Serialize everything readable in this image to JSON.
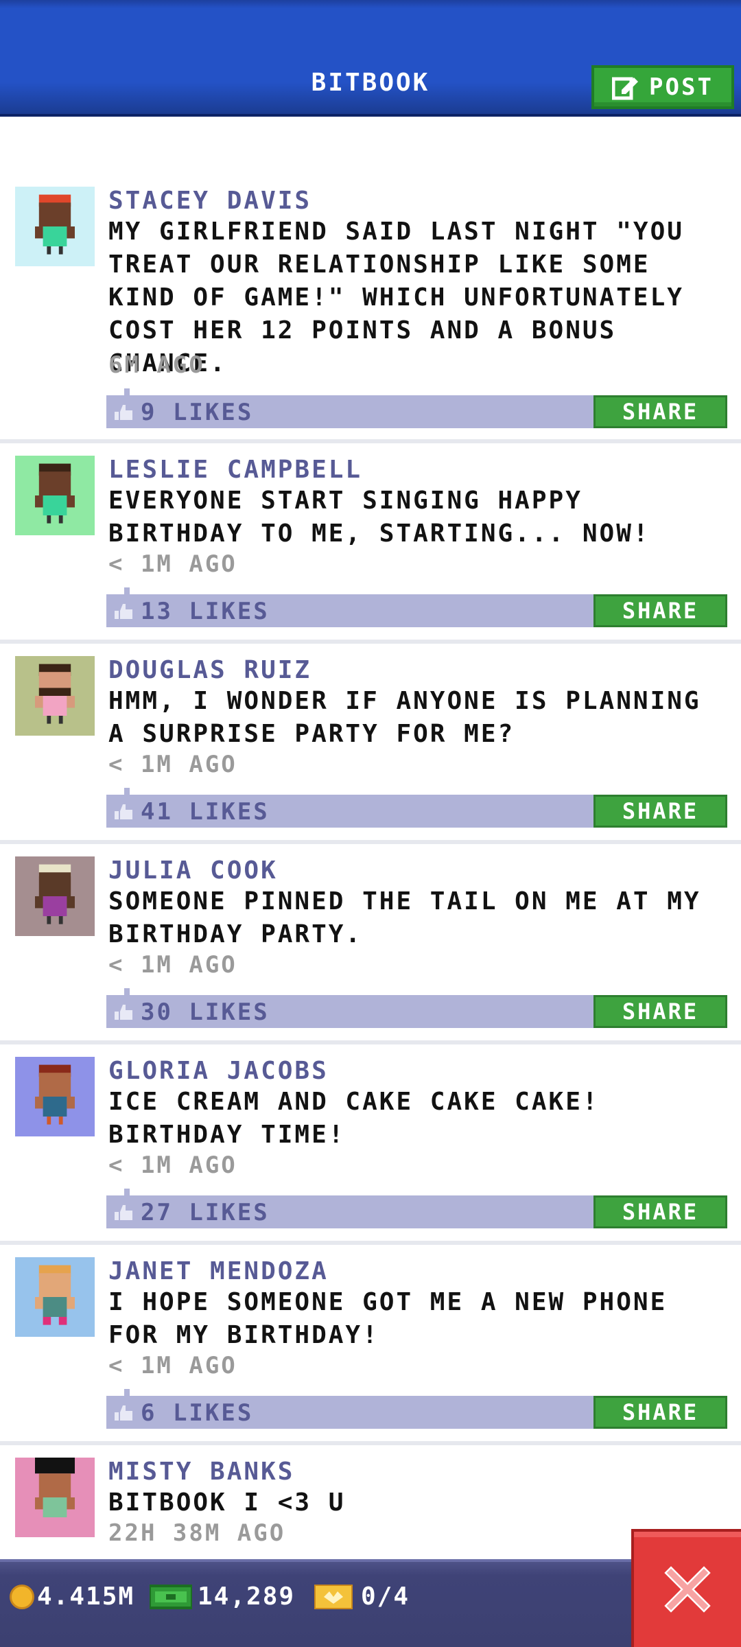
{
  "header": {
    "title": "BITBOOK",
    "post_label": "POST"
  },
  "posts": [
    {
      "author": "STACEY DAVIS",
      "message": "MY GIRLFRIEND SAID LAST NIGHT \"YOU TREAT OUR RELATIONSHIP LIKE SOME KIND OF GAME!\" WHICH UNFORTUNATELY COST HER 12 POINTS AND A BONUS CHANCE.",
      "time": "6M AGO",
      "likes": "9 LIKES",
      "share": "SHARE",
      "avatar_bg": "#cdf1f7",
      "skin": "#6b3f2a",
      "hair": "#e0472b",
      "shirt": "#39d49a"
    },
    {
      "author": "LESLIE CAMPBELL",
      "message": "EVERYONE START SINGING HAPPY BIRTHDAY TO ME, STARTING... NOW!",
      "time": "< 1M AGO",
      "likes": "13 LIKES",
      "share": "SHARE",
      "avatar_bg": "#8fe9a3",
      "skin": "#6b3f2a",
      "hair": "#3b2416",
      "shirt": "#39d49a"
    },
    {
      "author": "DOUGLAS RUIZ",
      "message": "HMM, I WONDER IF ANYONE IS PLANNING A SURPRISE PARTY FOR ME?",
      "time": "< 1M AGO",
      "likes": "41 LIKES",
      "share": "SHARE",
      "avatar_bg": "#b8c18a",
      "skin": "#d79a7c",
      "hair": "#3b2416",
      "shirt": "#f2a4c3"
    },
    {
      "author": "JULIA COOK",
      "message": "SOMEONE PINNED THE TAIL ON ME AT MY BIRTHDAY PARTY.",
      "time": "< 1M AGO",
      "likes": "30 LIKES",
      "share": "SHARE",
      "avatar_bg": "#a58e90",
      "skin": "#5a3a28",
      "hair": "#e8e4c8",
      "shirt": "#9a3fa0"
    },
    {
      "author": "GLORIA JACOBS",
      "message": "ICE CREAM AND CAKE CAKE CAKE! BIRTHDAY TIME!",
      "time": "< 1M AGO",
      "likes": "27 LIKES",
      "share": "SHARE",
      "avatar_bg": "#8e92e8",
      "skin": "#b06a47",
      "hair": "#8a2a1a",
      "shirt": "#2e6a8c"
    },
    {
      "author": "JANET MENDOZA",
      "message": "I HOPE SOMEONE GOT ME A NEW PHONE FOR MY BIRTHDAY!",
      "time": "< 1M AGO",
      "likes": "6 LIKES",
      "share": "SHARE",
      "avatar_bg": "#97c3ec",
      "skin": "#e2a778",
      "hair": "#e6a34d",
      "shirt": "#4c8c84"
    },
    {
      "author": "MISTY BANKS",
      "message": "BITBOOK I <3 U",
      "time": "22H 38M AGO",
      "likes": "",
      "share": "",
      "avatar_bg": "#e68fb8",
      "skin": "#b06a47",
      "hair": "#121212",
      "shirt": "#7ec49a"
    }
  ],
  "status_bar": {
    "coins": "4.415M",
    "bux": "14,289",
    "tickets": "0/4"
  },
  "colors": {
    "header": "#2452c6",
    "accent_green": "#3ea33f",
    "likes_bar": "#b0b3d8",
    "author_text": "#575a95",
    "close_red": "#e23a3a"
  }
}
